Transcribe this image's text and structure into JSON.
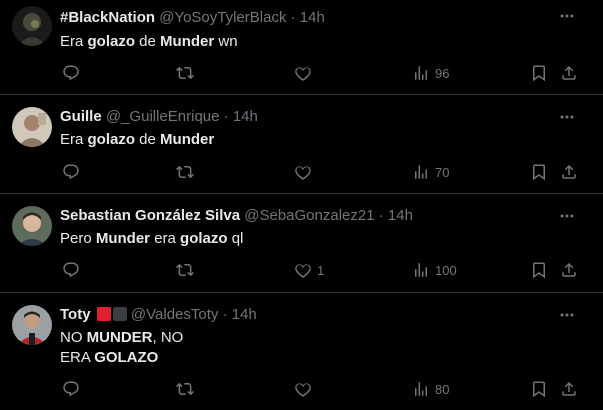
{
  "tweets": [
    {
      "name": "#BlackNation",
      "handle": "@YoSoyTylerBlack",
      "dot": "·",
      "time": "14h",
      "text_parts": [
        "Era ",
        "golazo",
        " de ",
        "Munder",
        " wn"
      ],
      "likes": "",
      "views": "96"
    },
    {
      "name": "Guille",
      "handle": "@_GuilleEnrique",
      "dot": "·",
      "time": "14h",
      "text_parts": [
        "Era ",
        "golazo",
        " de ",
        "Munder"
      ],
      "likes": "",
      "views": "70"
    },
    {
      "name": "Sebastian González Silva",
      "handle": "@SebaGonzalez21",
      "dot": "·",
      "time": "14h",
      "text_parts": [
        "Pero ",
        "Munder",
        " era ",
        "golazo",
        " ql"
      ],
      "likes": "1",
      "views": "100"
    },
    {
      "name": "Toty",
      "handle": "@ValdesToty",
      "dot": "·",
      "time": "14h",
      "text_parts": [
        "NO ",
        "MUNDER",
        ", NO",
        "ERA ",
        "GOLAZO"
      ],
      "likes": "",
      "views": "80"
    }
  ],
  "colors": {
    "background": "#000000",
    "text": "#e7e9ea",
    "muted": "#71767b",
    "divider": "#2f3336",
    "badge_red": "#e0202e"
  },
  "icons": [
    "more-icon",
    "reply-icon",
    "retweet-icon",
    "like-icon",
    "views-icon",
    "bookmark-icon",
    "share-icon"
  ]
}
